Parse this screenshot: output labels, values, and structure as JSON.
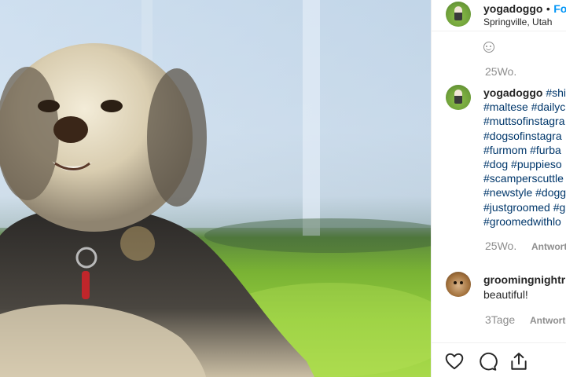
{
  "post": {
    "username": "yogadoggo",
    "separator": "•",
    "follow_label": "Fo",
    "location": "Springville, Utah"
  },
  "previous_comment": {
    "emoji": "smiley-icon",
    "time": "25Wo."
  },
  "caption": {
    "username": "yogadoggo",
    "lines": [
      "#shi",
      "#maltese #dailyc",
      "#muttsofinstagra",
      "#dogsofinstagra",
      "#furmom #furba",
      "#dog #puppieso",
      "#scamperscuttle",
      "#newstyle #dogg",
      "#justgroomed #g",
      "#groomedwithlo"
    ],
    "time": "25Wo.",
    "reply_label": "Antwort"
  },
  "comment": {
    "username": "groomingnightr",
    "text": "beautiful!",
    "time": "3Tage",
    "reply_label": "Antworte"
  },
  "actions": [
    "heart-icon",
    "comment-icon",
    "share-icon"
  ],
  "colors": {
    "link": "#00376b",
    "follow": "#0095f6",
    "muted": "#8e8e8e",
    "text": "#262626"
  }
}
